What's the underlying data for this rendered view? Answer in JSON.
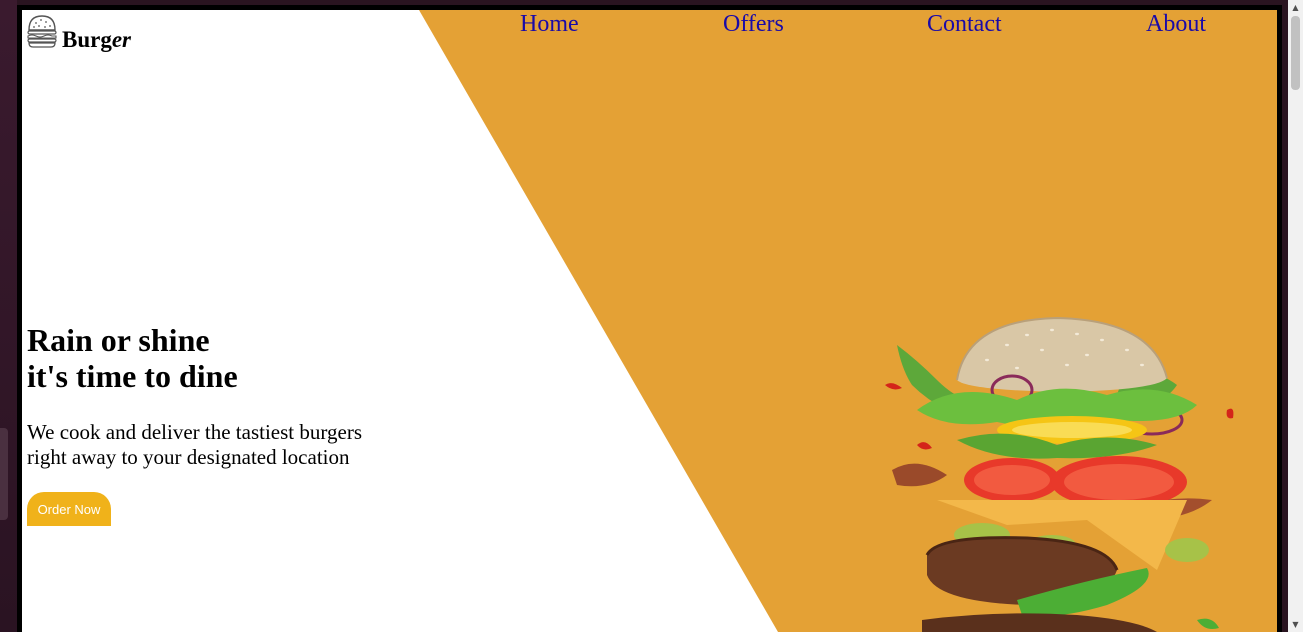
{
  "brand": {
    "name_bold": "Burg",
    "name_italic": "er",
    "icon": "burger-icon"
  },
  "nav": {
    "items": [
      {
        "label": "Home"
      },
      {
        "label": "Offers"
      },
      {
        "label": "Contact"
      },
      {
        "label": "About"
      }
    ]
  },
  "hero": {
    "title_line1": "Rain or shine",
    "title_line2": "it's time to dine",
    "text_line1": "We cook and deliver the tastiest burgers",
    "text_line2": "right away to your designated location",
    "cta_label": "Order Now"
  },
  "colors": {
    "accent_bg": "#e4a135",
    "button_bg": "#f0b21a",
    "nav_link": "#1a0aa8",
    "frame": "#000000"
  },
  "scrollbar": {
    "up_icon": "scroll-up-arrow-icon",
    "down_icon": "scroll-down-arrow-icon"
  }
}
